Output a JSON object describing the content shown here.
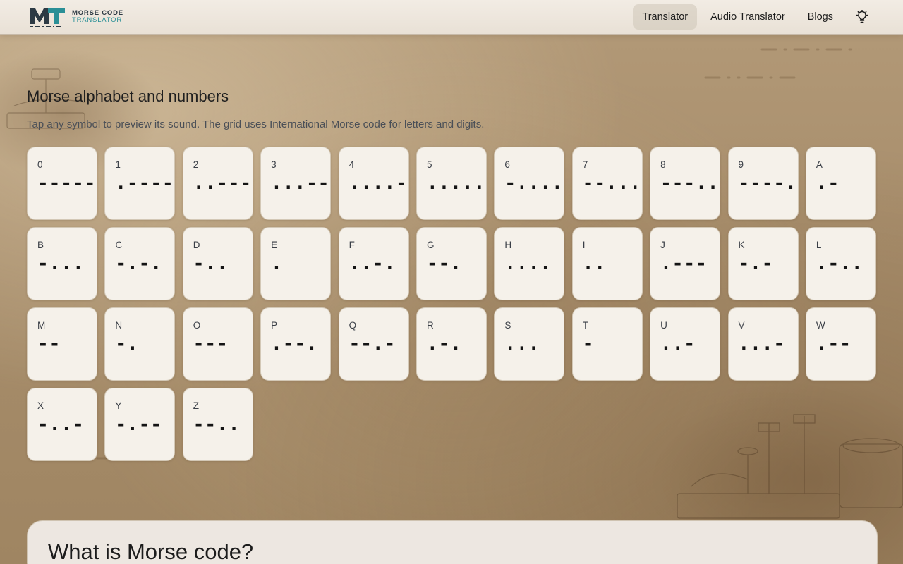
{
  "header": {
    "logo_line1": "MORSE CODE",
    "logo_line2": "TRANSLATOR",
    "nav": [
      {
        "label": "Translator",
        "active": true
      },
      {
        "label": "Audio Translator",
        "active": false
      },
      {
        "label": "Blogs",
        "active": false
      }
    ],
    "theme_icon": "lightbulb-icon"
  },
  "section": {
    "title": "Morse alphabet and numbers",
    "subtitle": "Tap any symbol to preview its sound. The grid uses International Morse code for letters and digits."
  },
  "symbols": [
    {
      "char": "0",
      "code": "-----"
    },
    {
      "char": "1",
      "code": ".----"
    },
    {
      "char": "2",
      "code": "..---"
    },
    {
      "char": "3",
      "code": "...--"
    },
    {
      "char": "4",
      "code": "....-"
    },
    {
      "char": "5",
      "code": "....."
    },
    {
      "char": "6",
      "code": "-...."
    },
    {
      "char": "7",
      "code": "--..."
    },
    {
      "char": "8",
      "code": "---.."
    },
    {
      "char": "9",
      "code": "----."
    },
    {
      "char": "A",
      "code": ".-"
    },
    {
      "char": "B",
      "code": "-..."
    },
    {
      "char": "C",
      "code": "-.-."
    },
    {
      "char": "D",
      "code": "-.."
    },
    {
      "char": "E",
      "code": "."
    },
    {
      "char": "F",
      "code": "..-."
    },
    {
      "char": "G",
      "code": "--."
    },
    {
      "char": "H",
      "code": "...."
    },
    {
      "char": "I",
      "code": ".."
    },
    {
      "char": "J",
      "code": ".---"
    },
    {
      "char": "K",
      "code": "-.-"
    },
    {
      "char": "L",
      "code": ".-.."
    },
    {
      "char": "M",
      "code": "--"
    },
    {
      "char": "N",
      "code": "-."
    },
    {
      "char": "O",
      "code": "---"
    },
    {
      "char": "P",
      "code": ".--."
    },
    {
      "char": "Q",
      "code": "--.-"
    },
    {
      "char": "R",
      "code": ".-."
    },
    {
      "char": "S",
      "code": "..."
    },
    {
      "char": "T",
      "code": "-"
    },
    {
      "char": "U",
      "code": "..-"
    },
    {
      "char": "V",
      "code": "...-"
    },
    {
      "char": "W",
      "code": ".--"
    },
    {
      "char": "X",
      "code": "-..-"
    },
    {
      "char": "Y",
      "code": "-.--"
    },
    {
      "char": "Z",
      "code": "--.."
    }
  ],
  "info": {
    "title": "What is Morse code?"
  },
  "colors": {
    "accent_teal": "#2a8f96",
    "tile_bg": "#f5f1ea",
    "parchment": "#a88e6c"
  }
}
